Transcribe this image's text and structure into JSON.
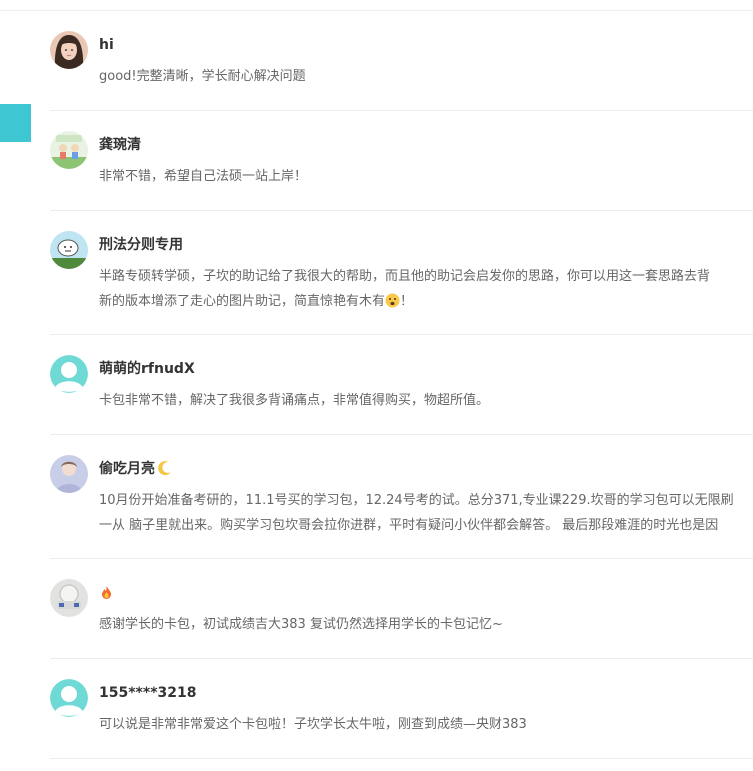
{
  "accent_color": "#3ec7d2",
  "comments": [
    {
      "name": "hi",
      "avatar_icon": "user-photo-avatar",
      "lines": [
        "good!完整清晰，学长耐心解决问题"
      ]
    },
    {
      "name": "龚琬清",
      "avatar_icon": "cartoon-avatar",
      "lines": [
        "非常不错，希望自己法硕一站上岸！"
      ]
    },
    {
      "name": "刑法分则专用",
      "avatar_icon": "cartoon-avatar",
      "lines": [
        "半路专硕转学硕，子坎的助记给了我很大的帮助，而且他的助记会启发你的思路，你可以用这一套思路去背",
        "新的版本增添了走心的图片助记，简直惊艳有木有",
        "！"
      ],
      "inline_emoji": "astonished-face-emoji"
    },
    {
      "name": "萌萌的rfnudX",
      "avatar_icon": "default-user-avatar",
      "lines": [
        "卡包非常不错，解决了我很多背诵痛点，非常值得购买，物超所值。"
      ]
    },
    {
      "name": "偷吃月亮",
      "name_emoji": "crescent-moon-emoji",
      "avatar_icon": "user-photo-avatar",
      "lines": [
        "10月份开始准备考研的，11.1号买的学习包，12.24号考的试。总分371,专业课229.坎哥的学习包可以无限刷",
        "一从 脑子里就出来。购买学习包坎哥会拉你进群，平时有疑问小伙伴都会解答。 最后那段难涯的时光也是因"
      ]
    },
    {
      "name": "",
      "name_emoji": "fire-emoji",
      "avatar_icon": "user-photo-avatar",
      "lines": [
        "感谢学长的卡包，初试成绩吉大383 复试仍然选择用学长的卡包记忆~"
      ]
    },
    {
      "name": "155****3218",
      "avatar_icon": "default-user-avatar",
      "lines": [
        "可以说是非常非常爱这个卡包啦！子坎学长太牛啦，刚查到成绩—央财383"
      ]
    }
  ]
}
